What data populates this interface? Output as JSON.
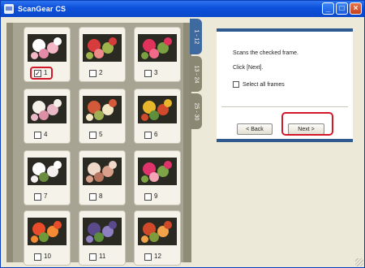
{
  "titlebar": {
    "title": "ScanGear CS"
  },
  "tabs": [
    {
      "label": "1 - 12",
      "active": true
    },
    {
      "label": "13 - 24",
      "active": false
    },
    {
      "label": "25 - 30",
      "active": false
    }
  ],
  "frames": [
    {
      "num": "1",
      "checked": true
    },
    {
      "num": "2",
      "checked": false
    },
    {
      "num": "3",
      "checked": false
    },
    {
      "num": "4",
      "checked": false
    },
    {
      "num": "5",
      "checked": false
    },
    {
      "num": "6",
      "checked": false
    },
    {
      "num": "7",
      "checked": false
    },
    {
      "num": "8",
      "checked": false
    },
    {
      "num": "9",
      "checked": false
    },
    {
      "num": "10",
      "checked": false
    },
    {
      "num": "11",
      "checked": false
    },
    {
      "num": "12",
      "checked": false
    }
  ],
  "panel": {
    "instruction": "Scans the checked frame.",
    "instruction2": "Click [Next].",
    "select_all_label": "Select all frames",
    "back_label": "< Back",
    "next_label": "Next >"
  },
  "colors": {
    "titlebar": "#0c4fd9",
    "highlight": "#d3182c",
    "panel_border": "#2e5a8f"
  }
}
